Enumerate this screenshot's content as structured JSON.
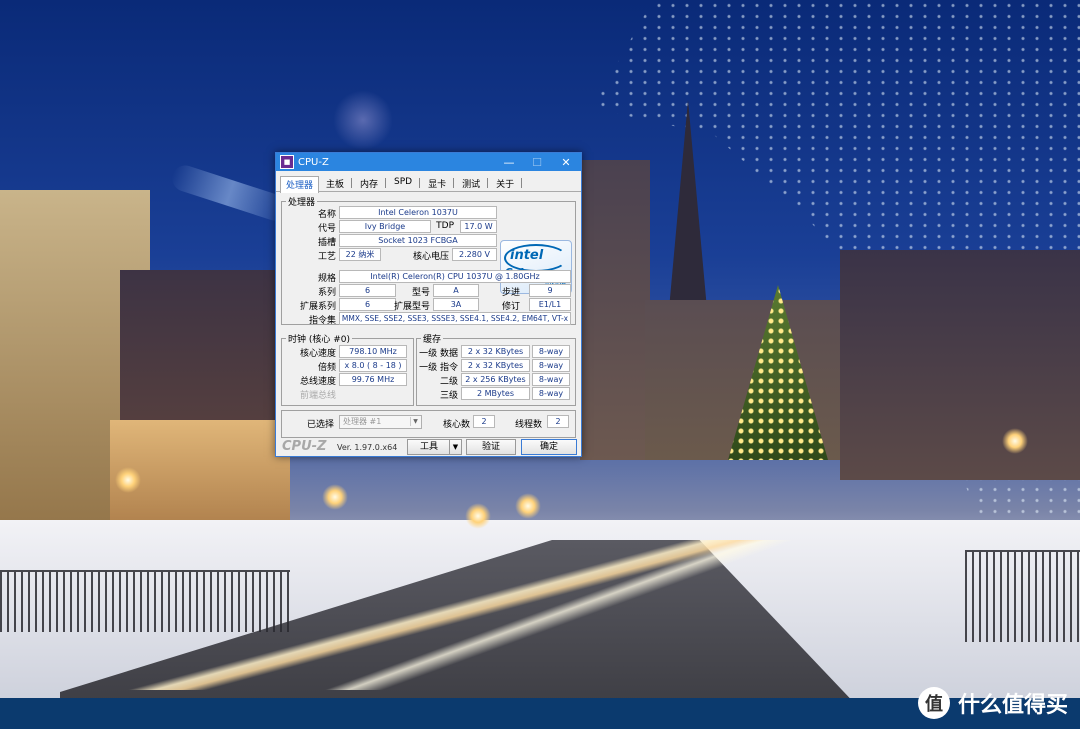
{
  "window": {
    "title": "CPU-Z",
    "minimize_glyph": "—",
    "maximize_glyph": "☐",
    "close_glyph": "✕",
    "accent_color": "#2b85e0"
  },
  "tabs": [
    "处理器",
    "主板",
    "内存",
    "SPD",
    "显卡",
    "测试",
    "关于"
  ],
  "active_tab": "处理器",
  "processor": {
    "group_label": "处理器",
    "name_label": "名称",
    "name": "Intel Celeron 1037U",
    "codename_label": "代号",
    "codename": "Ivy Bridge",
    "tdp_label": "TDP",
    "tdp": "17.0 W",
    "package_label": "插槽",
    "package": "Socket 1023 FCBGA",
    "technology_label": "工艺",
    "technology": "22 纳米",
    "voltage_label": "核心电压",
    "voltage": "2.280 V",
    "spec_label": "规格",
    "spec": "Intel(R) Celeron(R) CPU 1037U @ 1.80GHz",
    "family_label": "系列",
    "family": "6",
    "model_label": "型号",
    "model": "A",
    "stepping_label": "步进",
    "stepping": "9",
    "ext_family_label": "扩展系列",
    "ext_family": "6",
    "ext_model_label": "扩展型号",
    "ext_model": "3A",
    "revision_label": "修订",
    "revision": "E1/L1",
    "instructions_label": "指令集",
    "instructions": "MMX, SSE, SSE2, SSE3, SSSE3, SSE4.1, SSE4.2, EM64T, VT-x",
    "logo": {
      "brand": "intel",
      "product": "Celeron",
      "tag": "inside"
    }
  },
  "clocks": {
    "group_label": "时钟 (核心 #0)",
    "core_speed_label": "核心速度",
    "core_speed": "798.10 MHz",
    "multiplier_label": "倍频",
    "multiplier": "x 8.0 ( 8 - 18 )",
    "bus_speed_label": "总线速度",
    "bus_speed": "99.76 MHz",
    "rated_fsb_label": "前端总线",
    "rated_fsb": ""
  },
  "cache": {
    "group_label": "缓存",
    "l1d_label": "一级 数据",
    "l1d": "2 x 32 KBytes",
    "l1d_way": "8-way",
    "l1i_label": "一级 指令",
    "l1i": "2 x 32 KBytes",
    "l1i_way": "8-way",
    "l2_label": "二级",
    "l2": "2 x 256 KBytes",
    "l2_way": "8-way",
    "l3_label": "三级",
    "l3": "2 MBytes",
    "l3_way": "8-way"
  },
  "selection": {
    "selected_label": "已选择",
    "processor_select": "处理器 #1",
    "cores_label": "核心数",
    "cores": "2",
    "threads_label": "线程数",
    "threads": "2"
  },
  "footer": {
    "brand": "CPU-Z",
    "version": "Ver. 1.97.0.x64",
    "tools_label": "工具",
    "validate_label": "验证",
    "ok_label": "确定"
  },
  "watermark": {
    "logo_glyph": "值",
    "text": "什么值得买"
  }
}
